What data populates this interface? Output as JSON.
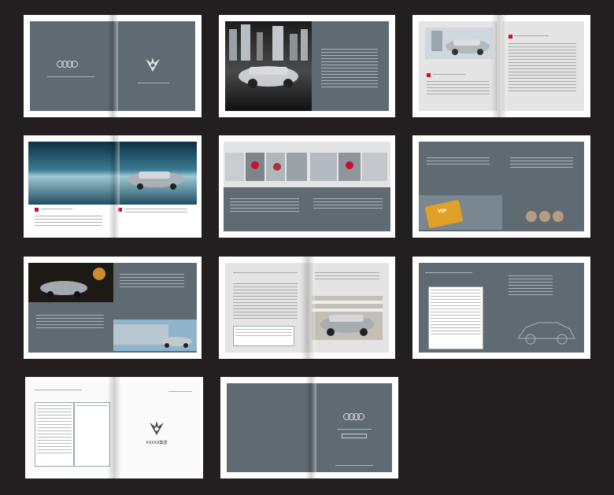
{
  "spread6": {
    "card_label": "VIP"
  },
  "spread10": {
    "company_cn": "XXXXX集团"
  },
  "colors": {
    "background": "#231f20",
    "page_gray": "#5f6a72",
    "page_light": "#e4e4e4",
    "brand_red": "#c8102e"
  }
}
